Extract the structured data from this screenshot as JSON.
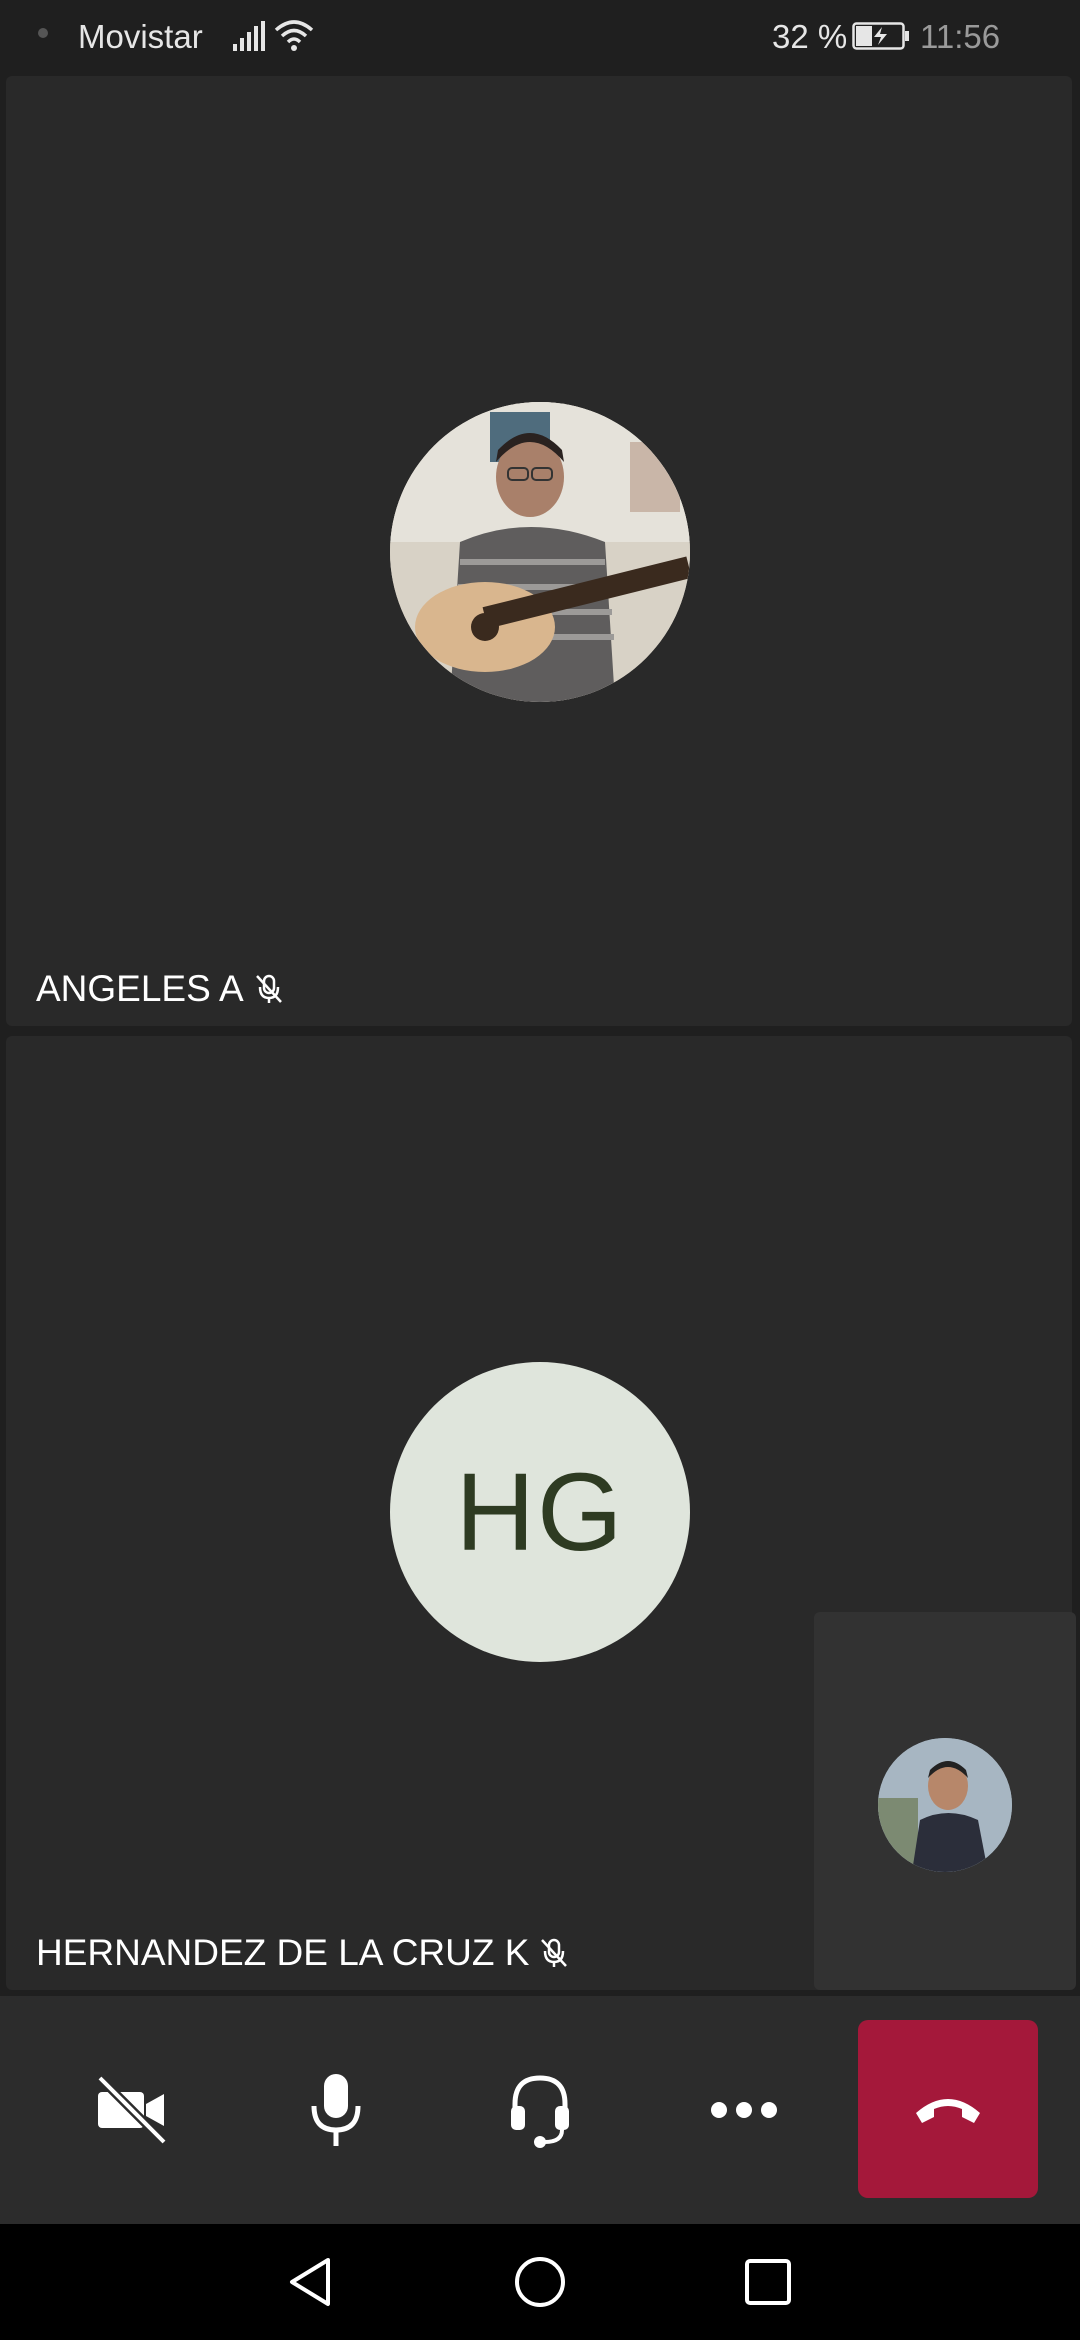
{
  "status_bar": {
    "carrier": "Movistar",
    "battery_percent": "32 %",
    "time": "11:56",
    "icons": [
      "signal-icon",
      "wifi-icon",
      "battery-charging-icon"
    ]
  },
  "participants": [
    {
      "name": "ANGELES A",
      "muted": true,
      "avatar": "photo"
    },
    {
      "name": "HERNANDEZ DE LA CRUZ K",
      "muted": true,
      "initials": "HG"
    }
  ],
  "self_preview": {
    "avatar": "photo"
  },
  "controls": {
    "icons": [
      "video-off-icon",
      "microphone-icon",
      "headset-icon",
      "more-icon",
      "hang-up-icon"
    ],
    "colors": {
      "hangup": "#a4183a",
      "bar": "#2c2c2c"
    }
  },
  "navbar": {
    "icons": [
      "back-icon",
      "home-icon",
      "recents-icon"
    ]
  }
}
